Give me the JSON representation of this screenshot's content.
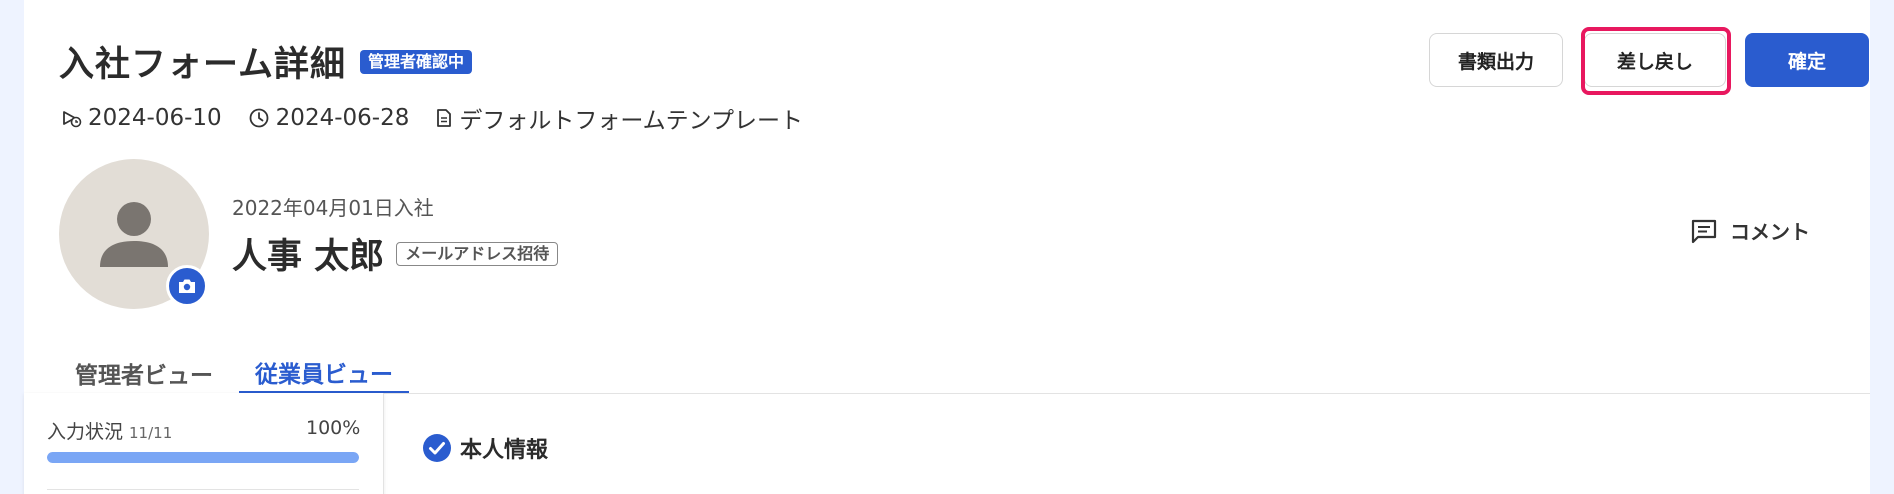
{
  "header": {
    "title": "入社フォーム詳細",
    "status_badge": "管理者確認中",
    "meta": {
      "sent_date": "2024-06-10",
      "deadline_date": "2024-06-28",
      "template_name": "デフォルトフォームテンプレート"
    },
    "buttons": {
      "export_label": "書類出力",
      "return_label": "差し戻し",
      "confirm_label": "確定"
    }
  },
  "profile": {
    "join_date": "2022年04月01日入社",
    "name": "人事 太郎",
    "invite_badge": "メールアドレス招待",
    "comment_label": "コメント"
  },
  "tabs": [
    {
      "label": "管理者ビュー",
      "active": false
    },
    {
      "label": "従業員ビュー",
      "active": true
    }
  ],
  "progress": {
    "label": "入力状況",
    "count": "11/11",
    "percent_text": "100%",
    "value": 1.0
  },
  "section": {
    "title": "本人情報"
  },
  "colors": {
    "accent": "#2a5ccf",
    "focus_ring": "#e8185f",
    "progress": "#7aa6f5",
    "page_bg": "#eef3ff"
  }
}
